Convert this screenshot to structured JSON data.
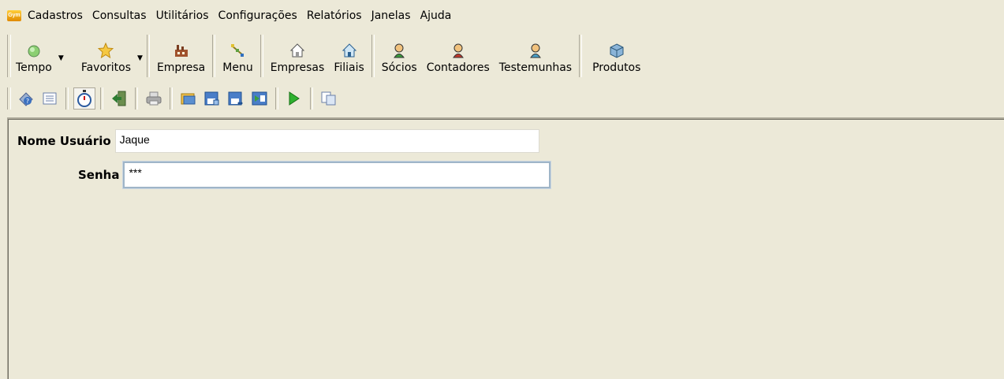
{
  "menubar": {
    "app_icon_text": "Gym",
    "items": [
      "Cadastros",
      "Consultas",
      "Utilitários",
      "Configurações",
      "Relatórios",
      "Janelas",
      "Ajuda"
    ]
  },
  "toolbar": {
    "tempo": "Tempo",
    "favoritos": "Favoritos",
    "empresa": "Empresa",
    "menu": "Menu",
    "empresas": "Empresas",
    "filiais": "Filiais",
    "socios": "Sócios",
    "contadores": "Contadores",
    "testemunhas": "Testemunhas",
    "produtos": "Produtos"
  },
  "small_toolbar": {
    "icons": [
      "help-icon",
      "list-icon",
      "stopwatch-icon",
      "exit-icon",
      "print-icon",
      "open-folder-icon",
      "save-icon",
      "save-all-icon",
      "export-icon",
      "run-icon",
      "copy-icon"
    ]
  },
  "form": {
    "user_label": "Nome Usuário",
    "user_value": "Jaque",
    "password_label": "Senha",
    "password_value": "***"
  }
}
